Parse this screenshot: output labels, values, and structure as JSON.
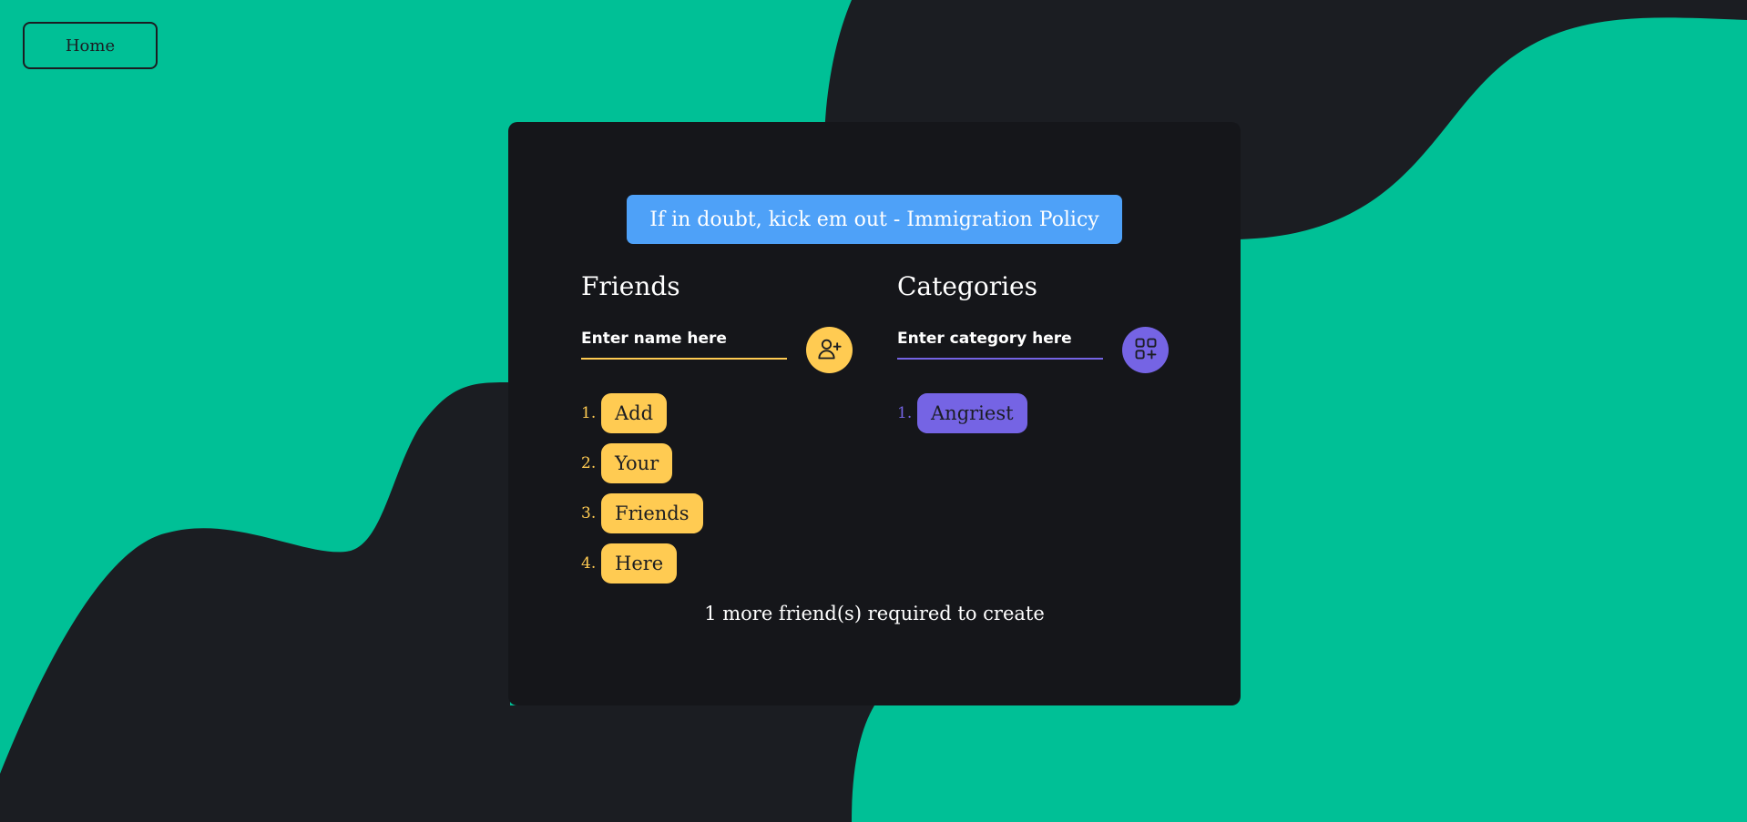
{
  "colors": {
    "page_background": "#00c096",
    "wave": "#1b1d22",
    "card": "#15161a",
    "banner": "#4ea1f8",
    "friends_accent": "#ffcb52",
    "categories_accent": "#7564e4",
    "text": "#ffffff"
  },
  "nav": {
    "home_label": "Home"
  },
  "banner": {
    "text": "If in doubt, kick em out - Immigration Policy"
  },
  "friends": {
    "title": "Friends",
    "input_placeholder": "Enter name here",
    "add_icon": "user-plus-icon",
    "items": [
      {
        "number": "1.",
        "label": "Add"
      },
      {
        "number": "2.",
        "label": "Your"
      },
      {
        "number": "3.",
        "label": "Friends"
      },
      {
        "number": "4.",
        "label": "Here"
      }
    ]
  },
  "categories": {
    "title": "Categories",
    "input_placeholder": "Enter category here",
    "add_icon": "grid-plus-icon",
    "items": [
      {
        "number": "1.",
        "label": "Angriest"
      }
    ]
  },
  "status": {
    "text": "1 more friend(s) required to create"
  }
}
